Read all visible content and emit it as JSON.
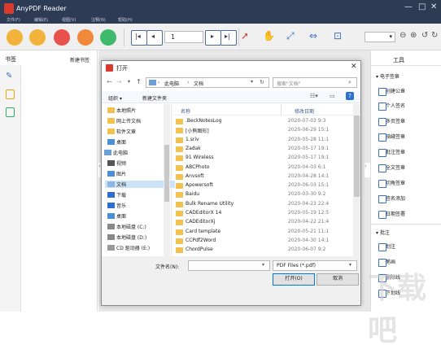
{
  "app": {
    "title": "AnyPDF Reader",
    "brand_color": "#d93a2b",
    "titlebar_color": "#2d3b55"
  },
  "menu": [
    "文件(F)",
    "编辑(E)",
    "视图(V)",
    "注释(N)",
    "帮助(H)"
  ],
  "toolbar": {
    "page_number": "1",
    "buttons": [
      "open-file-icon",
      "save-icon",
      "save-as-icon",
      "export-icon",
      "print-icon",
      "first-page-icon",
      "prev-page-icon",
      "next-page-icon",
      "last-page-icon",
      "select-icon",
      "hand-icon",
      "fit-page-icon",
      "fit-width-icon",
      "actual-size-icon",
      "zoom-out-icon",
      "zoom-in-icon",
      "rotate-left-icon",
      "rotate-right-icon"
    ]
  },
  "left_panel": {
    "title": "书签",
    "new_bookmark": "新建书签"
  },
  "right_panel": {
    "title": "工具",
    "sections": [
      {
        "header": "电子签章",
        "items": [
          "创建公章",
          "个人签名",
          "多页签章",
          "骑缝签章",
          "批注签章",
          "全文签章",
          "切角签章",
          "签名添加",
          "日期签署"
        ]
      },
      {
        "header": "批注",
        "items": [
          "划注",
          "笔画",
          "删除线",
          "下划线"
        ]
      }
    ]
  },
  "dialog": {
    "title": "打开",
    "path": [
      "此电脑",
      "文档"
    ],
    "search_placeholder": "搜索\"文档\"",
    "organize": "组织 ▾",
    "new_folder": "新建文件夹",
    "col_name": "名称",
    "col_date": "修改日期",
    "nav": [
      {
        "label": "本地照片",
        "icon": "folder"
      },
      {
        "label": "网上传文档",
        "icon": "folder"
      },
      {
        "label": "软件文章",
        "icon": "folder"
      },
      {
        "label": "桌面",
        "icon": "desktop"
      },
      {
        "label": "此电脑",
        "icon": "pc"
      },
      {
        "label": "视频",
        "icon": "video"
      },
      {
        "label": "图片",
        "icon": "image"
      },
      {
        "label": "文档",
        "icon": "doc"
      },
      {
        "label": "下载",
        "icon": "download"
      },
      {
        "label": "音乐",
        "icon": "music"
      },
      {
        "label": "桌面",
        "icon": "desktop"
      },
      {
        "label": "本地磁盘 (C:)",
        "icon": "disk"
      },
      {
        "label": "本地磁盘 (D:)",
        "icon": "disk"
      },
      {
        "label": "CD 驱动器 (E:)",
        "icon": "cd"
      }
    ],
    "files": [
      {
        "name": ".BeckNotesLog",
        "date": "2020-07-03 9:3"
      },
      {
        "name": "[小熊图形]",
        "date": "2020-06-29 15:1"
      },
      {
        "name": "1.sriv",
        "date": "2020-05-28 11:1"
      },
      {
        "name": "Zadak",
        "date": "2020-05-17 19:1"
      },
      {
        "name": "91 Wireless",
        "date": "2020-05-17 19:1"
      },
      {
        "name": "ABCPhoto",
        "date": "2020-04-03 6:1"
      },
      {
        "name": "Anvsoft",
        "date": "2020-04-28 14:1"
      },
      {
        "name": "Apowersoft",
        "date": "2020-06-03 15:1"
      },
      {
        "name": "Baidu",
        "date": "2020-03-30 9:2"
      },
      {
        "name": "Bulk Rename Utility",
        "date": "2020-04-23 22:4"
      },
      {
        "name": "CADEditorX 14",
        "date": "2020-05-19 12:5"
      },
      {
        "name": "CADEditorXj",
        "date": "2020-04-22 21:4"
      },
      {
        "name": "Card template",
        "date": "2020-05-21 11:1"
      },
      {
        "name": "CCPdf2Word",
        "date": "2020-04-30 14:1"
      },
      {
        "name": "ChordPulse",
        "date": "2020-06-07 9:2"
      }
    ],
    "filename_label": "文件名(N):",
    "filename_value": "",
    "filetype": "PDF Files (*.pdf)",
    "open_btn": "打开(O)",
    "cancel_btn": "取消"
  },
  "watermark": "下载吧"
}
